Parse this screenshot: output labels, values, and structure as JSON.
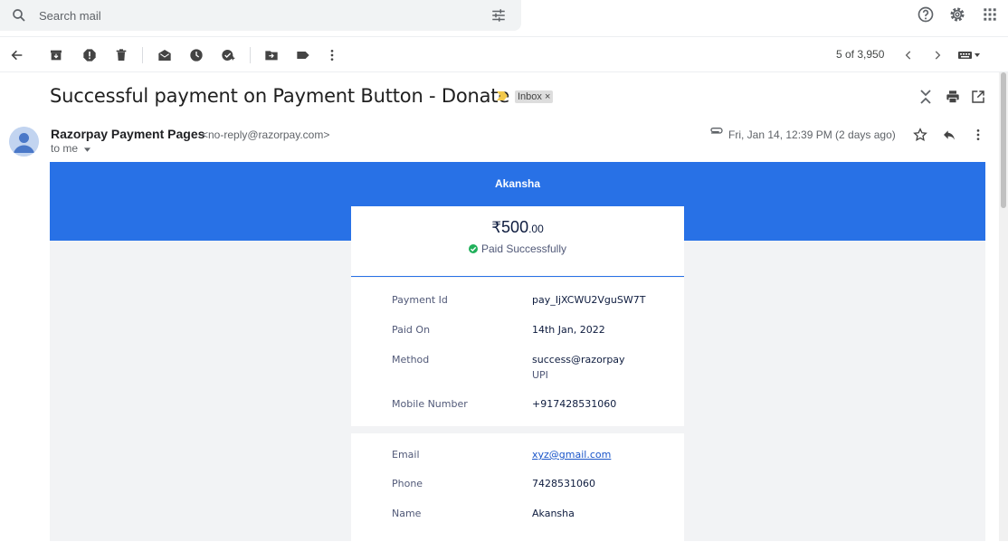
{
  "search": {
    "placeholder": "Search mail"
  },
  "toolbar": {
    "pager": "5 of 3,950"
  },
  "message": {
    "subject": "Successful payment on Payment Button - Donate",
    "label": "Inbox",
    "label_close": "×",
    "sender_name": "Razorpay Payment Pages",
    "sender_email": "<no-reply@razorpay.com>",
    "to": "to me",
    "date": "Fri, Jan 14, 12:39 PM (2 days ago)"
  },
  "receipt": {
    "payer_name": "Akansha",
    "currency_symbol": "₹",
    "amount_whole": "500",
    "amount_decimal": ".00",
    "status": "Paid Successfully",
    "details": [
      {
        "label": "Payment Id",
        "value": "pay_IjXCWU2VguSW7T"
      },
      {
        "label": "Paid On",
        "value": "14th Jan, 2022"
      },
      {
        "label": "Method",
        "value": "success@razorpay",
        "sub": "UPI"
      },
      {
        "label": "Mobile Number",
        "value": "+917428531060"
      }
    ],
    "customer": [
      {
        "label": "Email",
        "value": "xyz@gmail.com"
      },
      {
        "label": "Phone",
        "value": "7428531060"
      },
      {
        "label": "Name",
        "value": "Akansha"
      }
    ]
  },
  "colors": {
    "banner": "#2871e6",
    "success": "#20b05a"
  }
}
